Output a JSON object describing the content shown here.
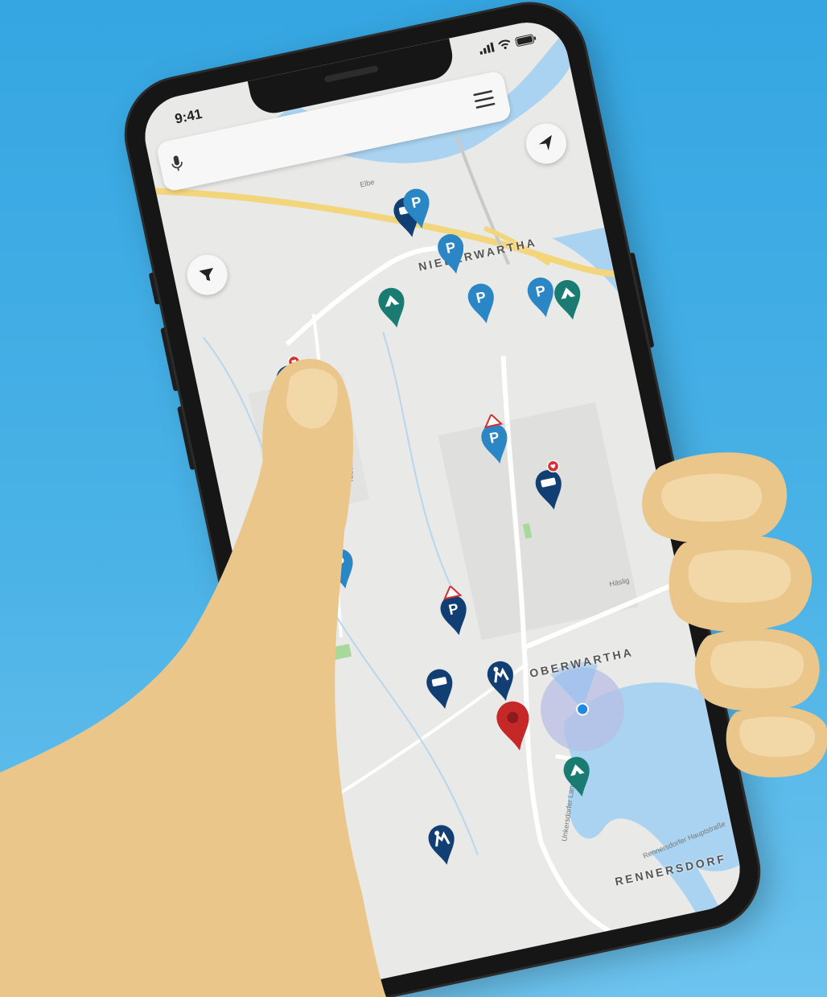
{
  "status_bar": {
    "time": "9:41"
  },
  "search": {
    "placeholder": ""
  },
  "map": {
    "places": {
      "niederwartha": "NIEDERWARTHA",
      "oberwartha": "OBERWARTHA",
      "rennersdorf": "RENNERSDORF"
    },
    "streets": {
      "elbe": "Elbe",
      "niederwarthaer": "Niederwarthaer Str.",
      "haeslig": "Häslig",
      "unkersdorfer": "Unkersdorfer Landstr.",
      "rennersdorfer": "Rennersdorfer Hauptstraße"
    }
  },
  "icons": {
    "mic": "mic-icon",
    "menu": "hamburger-menu-icon",
    "locate": "navigation-arrow-icon",
    "filter": "filter-funnel-icon",
    "parking": "parking-pin-icon",
    "camping": "camping-pin-icon",
    "camper": "camper-pin-icon",
    "playground": "playground-pin-icon",
    "destination": "destination-pin-icon"
  },
  "colors": {
    "background": "#3aa9e4",
    "parking_light": "#2a86c4",
    "parking_dark": "#123f73",
    "camping": "#1a7b72",
    "destination": "#c62828",
    "location_dot": "#1e88e5"
  }
}
